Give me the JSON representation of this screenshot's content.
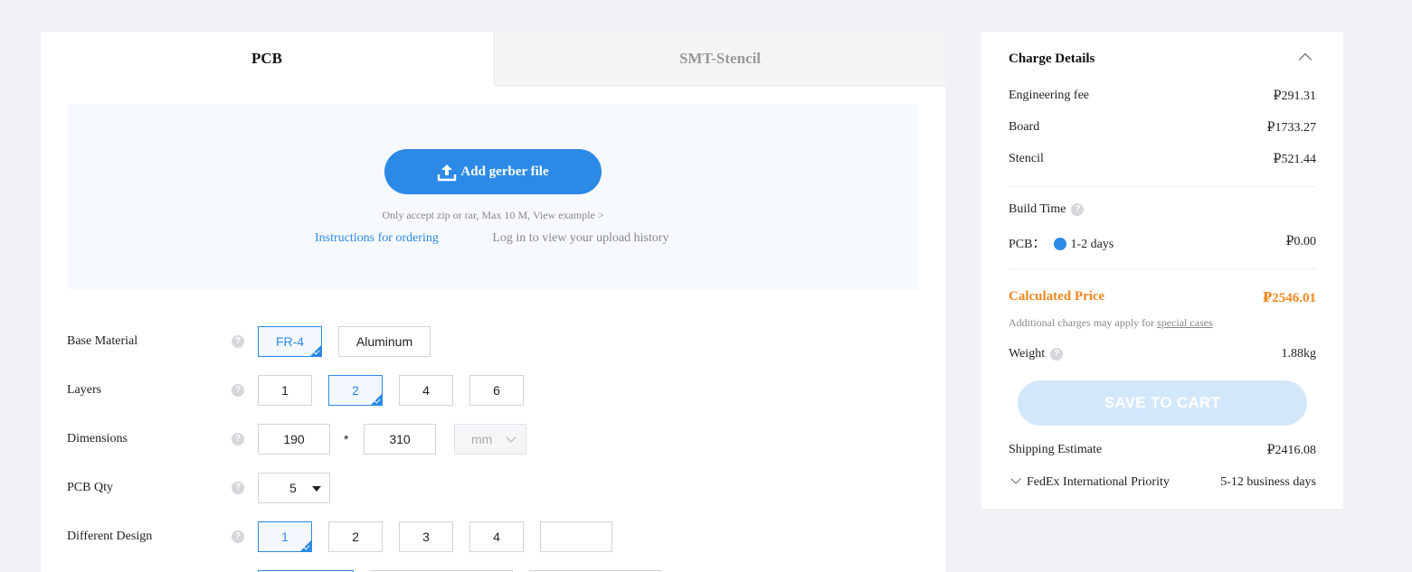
{
  "tabs": {
    "pcb": "PCB",
    "smt": "SMT-Stencil"
  },
  "upload": {
    "button_label": "Add gerber file",
    "note": "Only accept zip or rar, Max 10 M, View example >",
    "instructions_link": "Instructions for ordering",
    "history_link": "Log in to view your upload history"
  },
  "options": {
    "base_material": {
      "label": "Base Material",
      "choices": [
        "FR-4",
        "Aluminum"
      ],
      "selected": "FR-4"
    },
    "layers": {
      "label": "Layers",
      "choices": [
        "1",
        "2",
        "4",
        "6"
      ],
      "selected": "2"
    },
    "dimensions": {
      "label": "Dimensions",
      "width": "190",
      "times": "*",
      "height": "310",
      "unit": "mm"
    },
    "pcb_qty": {
      "label": "PCB Qty",
      "value": "5"
    },
    "different_design": {
      "label": "Different Design",
      "choices": [
        "1",
        "2",
        "3",
        "4",
        ""
      ],
      "selected": "1"
    },
    "help_glyph": "?"
  },
  "charge": {
    "title": "Charge Details",
    "engineering_fee": {
      "label": "Engineering fee",
      "value": "₽291.31"
    },
    "board": {
      "label": "Board",
      "value": "₽1733.27"
    },
    "stencil": {
      "label": "Stencil",
      "value": "₽521.44"
    },
    "build_time": {
      "label": "Build Time",
      "pcb_label": "PCB：",
      "option": "1-2 days",
      "value": "₽0.00"
    },
    "calculated": {
      "label": "Calculated Price",
      "value": "₽2546.01"
    },
    "note_prefix": "Additional charges may apply for ",
    "note_link": "special cases",
    "weight": {
      "label": "Weight",
      "value": "1.88kg"
    },
    "save_label": "SAVE TO CART",
    "shipping": {
      "label": "Shipping Estimate",
      "value": "₽2416.08",
      "method": "FedEx International Priority",
      "days": "5-12 business days"
    }
  },
  "colors": {
    "accent": "#2c8ae6",
    "price": "#f0871e",
    "save_disabled": "#d3e7fb",
    "background": "#f1f2f5"
  }
}
